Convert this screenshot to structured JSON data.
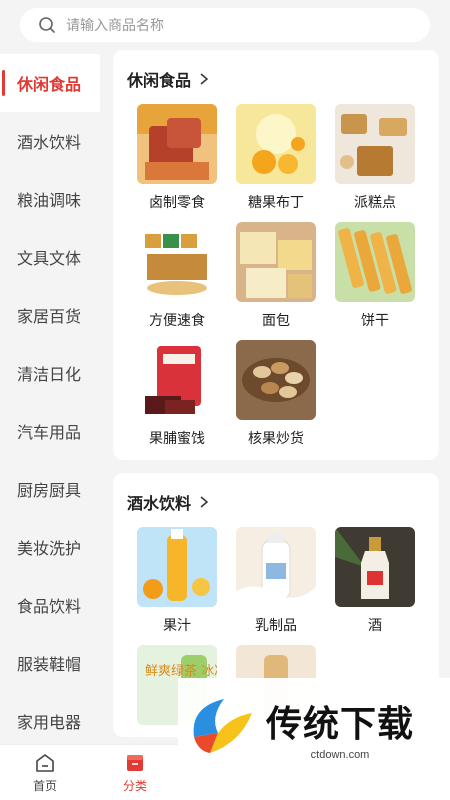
{
  "search": {
    "placeholder": "请输入商品名称"
  },
  "sidebar": {
    "items": [
      {
        "label": "休闲食品",
        "active": true
      },
      {
        "label": "酒水饮料"
      },
      {
        "label": "粮油调味"
      },
      {
        "label": "文具文体"
      },
      {
        "label": "家居百货"
      },
      {
        "label": "清洁日化"
      },
      {
        "label": "汽车用品"
      },
      {
        "label": "厨房厨具"
      },
      {
        "label": "美妆洗护"
      },
      {
        "label": "食品饮料"
      },
      {
        "label": "服装鞋帽"
      },
      {
        "label": "家用电器"
      }
    ]
  },
  "sections": [
    {
      "title": "休闲食品",
      "items": [
        {
          "label": "卤制零食",
          "icon": "braised-snack-image"
        },
        {
          "label": "糖果布丁",
          "icon": "pudding-image"
        },
        {
          "label": "派糕点",
          "icon": "pastry-image"
        },
        {
          "label": "方便速食",
          "icon": "instant-food-image"
        },
        {
          "label": "面包",
          "icon": "bread-image"
        },
        {
          "label": "饼干",
          "icon": "biscuit-image"
        },
        {
          "label": "果脯蜜饯",
          "icon": "dried-fruit-image"
        },
        {
          "label": "核果炒货",
          "icon": "nuts-image"
        }
      ]
    },
    {
      "title": "酒水饮料",
      "items": [
        {
          "label": "果汁",
          "icon": "juice-image"
        },
        {
          "label": "乳制品",
          "icon": "dairy-image"
        },
        {
          "label": "酒",
          "icon": "liquor-image"
        },
        {
          "label": "",
          "icon": "green-tea-image",
          "overlay_text": "鲜爽绿茶 冰凉一夏"
        },
        {
          "label": "",
          "icon": "drink-image"
        }
      ]
    }
  ],
  "bottom_nav": [
    {
      "label": "首页",
      "icon": "home-icon"
    },
    {
      "label": "分类",
      "icon": "category-icon",
      "active": true
    }
  ],
  "watermark": {
    "title": "传统下载",
    "url": "ctdown.com"
  },
  "colors": {
    "accent": "#e03a32",
    "background": "#f4f4f4"
  }
}
